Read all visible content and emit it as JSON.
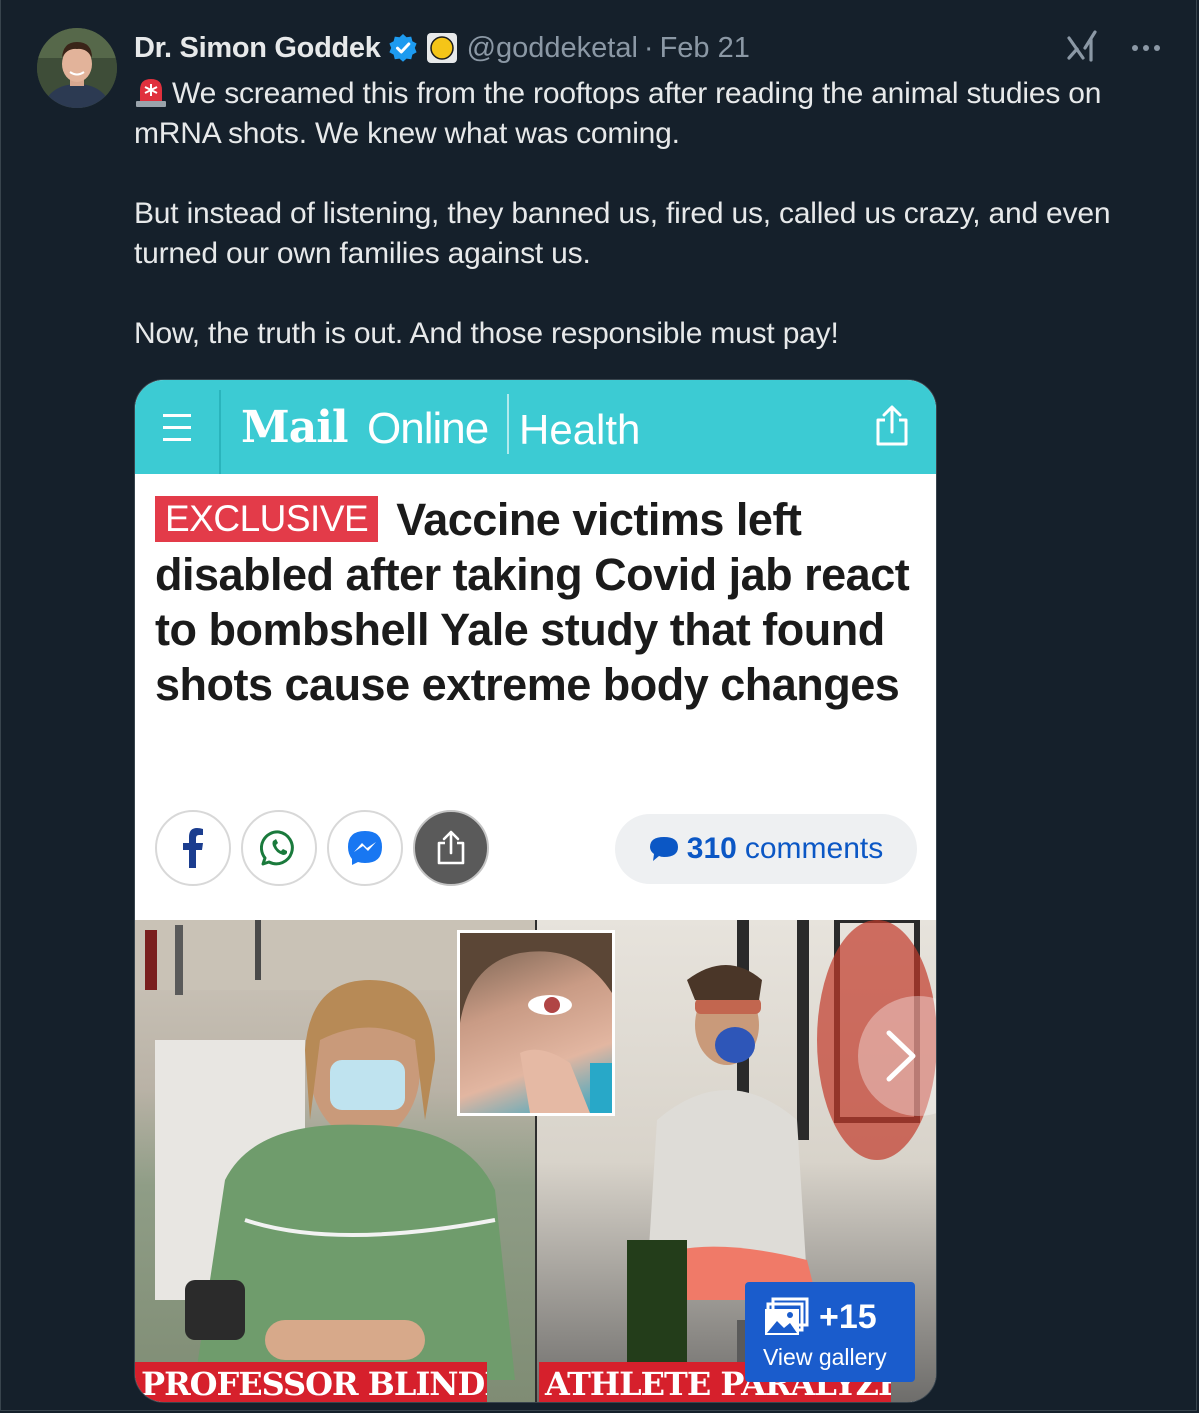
{
  "tweet": {
    "author_name": "Dr. Simon Goddek",
    "handle": "@goddeketal",
    "separator": "·",
    "date": "Feb 21",
    "paragraphs": [
      "We screamed this from the rooftops after reading the animal studies on mRNA shots. We knew what was coming.",
      "But instead of listening, they banned us, fired us, called us crazy, and even turned our own families against us.",
      "Now, the truth is out. And those responsible must pay!"
    ],
    "lead_emoji": "siren-icon"
  },
  "article": {
    "site_logo": "Mail",
    "site_logo_suffix": "Online",
    "section": "Health",
    "badge": "EXCLUSIVE",
    "headline": "Vaccine victims left disabled after taking Covid jab react to bombshell Yale study that found shots cause extreme body changes",
    "comments_count": "310",
    "comments_label": "comments",
    "caption_left": "PROFESSOR BLINDED",
    "caption_right": "ATHLETE PARALYZED",
    "gallery_count": "+15",
    "gallery_label": "View gallery"
  },
  "colors": {
    "background": "#15202b",
    "mailonline_teal": "#3ccbd3",
    "exclusive_red": "#e33b49",
    "caption_red": "#d6202c",
    "link_blue": "#0b57c5",
    "gallery_blue": "#1a5ccc"
  }
}
